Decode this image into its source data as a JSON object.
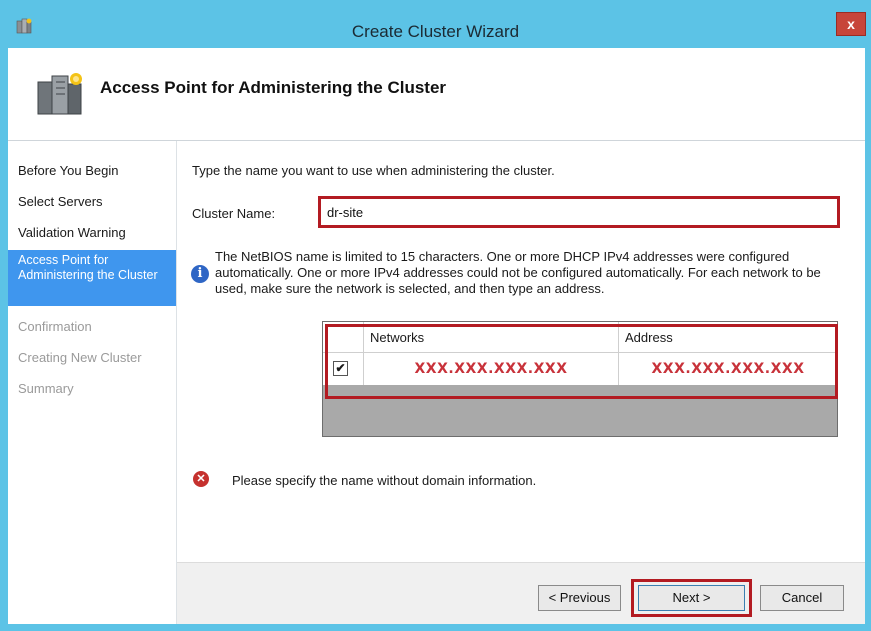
{
  "window": {
    "title": "Create Cluster Wizard",
    "close_label": "x"
  },
  "header": {
    "title": "Access Point for Administering the Cluster"
  },
  "sidebar": {
    "steps": [
      {
        "label": "Before You Begin",
        "state": "done"
      },
      {
        "label": "Select Servers",
        "state": "done"
      },
      {
        "label": "Validation Warning",
        "state": "done"
      },
      {
        "label": "Access Point for Administering the Cluster",
        "state": "current"
      },
      {
        "label": "Confirmation",
        "state": "pending"
      },
      {
        "label": "Creating New Cluster",
        "state": "pending"
      },
      {
        "label": "Summary",
        "state": "pending"
      }
    ]
  },
  "main": {
    "intro": "Type the name you want to use when administering the cluster.",
    "cluster_name_label": "Cluster Name:",
    "cluster_name_value": "dr-site",
    "info_text": "The NetBIOS name is limited to 15 characters.  One or more DHCP IPv4 addresses were configured automatically.  One or more IPv4 addresses could not be configured automatically.  For each network to be used, make sure the network is selected, and then type an address.",
    "networks_table": {
      "columns": [
        "Networks",
        "Address"
      ],
      "rows": [
        {
          "checked": true,
          "network": "XXX.XXX.XXX.XXX",
          "address": "XXX.XXX.XXX.XXX"
        }
      ]
    },
    "error_text": "Please specify the name without domain information."
  },
  "footer": {
    "previous_label": "< Previous",
    "next_label": "Next >",
    "cancel_label": "Cancel"
  },
  "colors": {
    "accent": "#5cc3e6",
    "selected_step": "#3f96ee",
    "highlight": "#b31b22",
    "masked_text": "#c8323a"
  },
  "icons": {
    "title": "wizard-server-icon",
    "header": "cluster-servers-icon",
    "info": "info-icon",
    "error": "error-icon",
    "check": "checkmark-icon"
  }
}
